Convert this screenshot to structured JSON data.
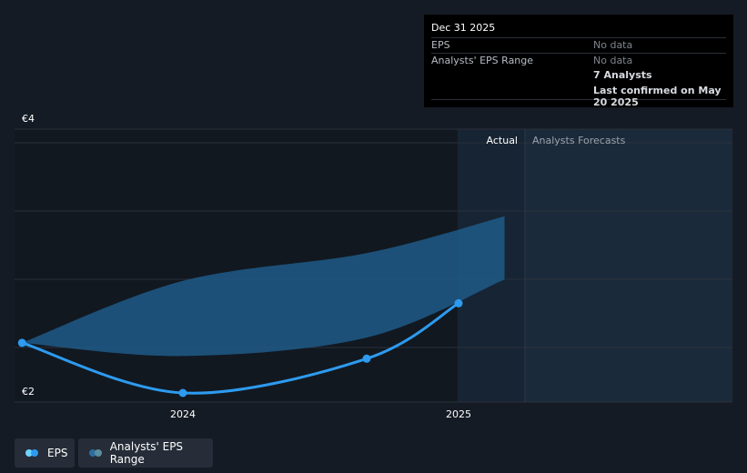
{
  "chart_data": {
    "type": "line",
    "y_axis": {
      "ticks": [
        "€4",
        "€2"
      ],
      "ylim": [
        2,
        4
      ]
    },
    "x_axis": {
      "ticks": [
        "2024",
        "2025"
      ]
    },
    "region_labels": {
      "actual": "Actual",
      "forecast": "Analysts Forecasts"
    },
    "series": [
      {
        "name": "EPS",
        "points": [
          {
            "x": "2023-06",
            "y": 2.38
          },
          {
            "x": "2024-01",
            "y": 2.0
          },
          {
            "x": "2024-09",
            "y": 2.26
          },
          {
            "x": "2025-01",
            "y": 2.68
          }
        ]
      },
      {
        "name": "Analysts' EPS Range",
        "upper": [
          {
            "x": "2023-06",
            "y": 2.38
          },
          {
            "x": "2024-01",
            "y": 2.85
          },
          {
            "x": "2024-09",
            "y": 3.06
          },
          {
            "x": "2025-03",
            "y": 3.34
          }
        ],
        "lower": [
          {
            "x": "2023-06",
            "y": 2.38
          },
          {
            "x": "2024-01",
            "y": 2.28
          },
          {
            "x": "2024-09",
            "y": 2.42
          },
          {
            "x": "2025-03",
            "y": 2.86
          }
        ]
      }
    ],
    "grid": true,
    "legend_position": "bottom-left"
  },
  "tooltip": {
    "date": "Dec 31 2025",
    "rows": [
      {
        "label": "EPS",
        "value": "No data"
      },
      {
        "label": "Analysts' EPS Range",
        "value": "No data"
      }
    ],
    "analysts": "7 Analysts",
    "confirmed": "Last confirmed on May 20 2025"
  },
  "legend": [
    {
      "label": "EPS",
      "color": "#2d9bf0"
    },
    {
      "label": "Analysts' EPS Range",
      "color": "#2e6e9e"
    }
  ],
  "colors": {
    "background": "#151b24",
    "eps_line": "#2d9bf0",
    "range_fill": "#1f5a88",
    "forecast_bg": "#1b2a3a"
  }
}
